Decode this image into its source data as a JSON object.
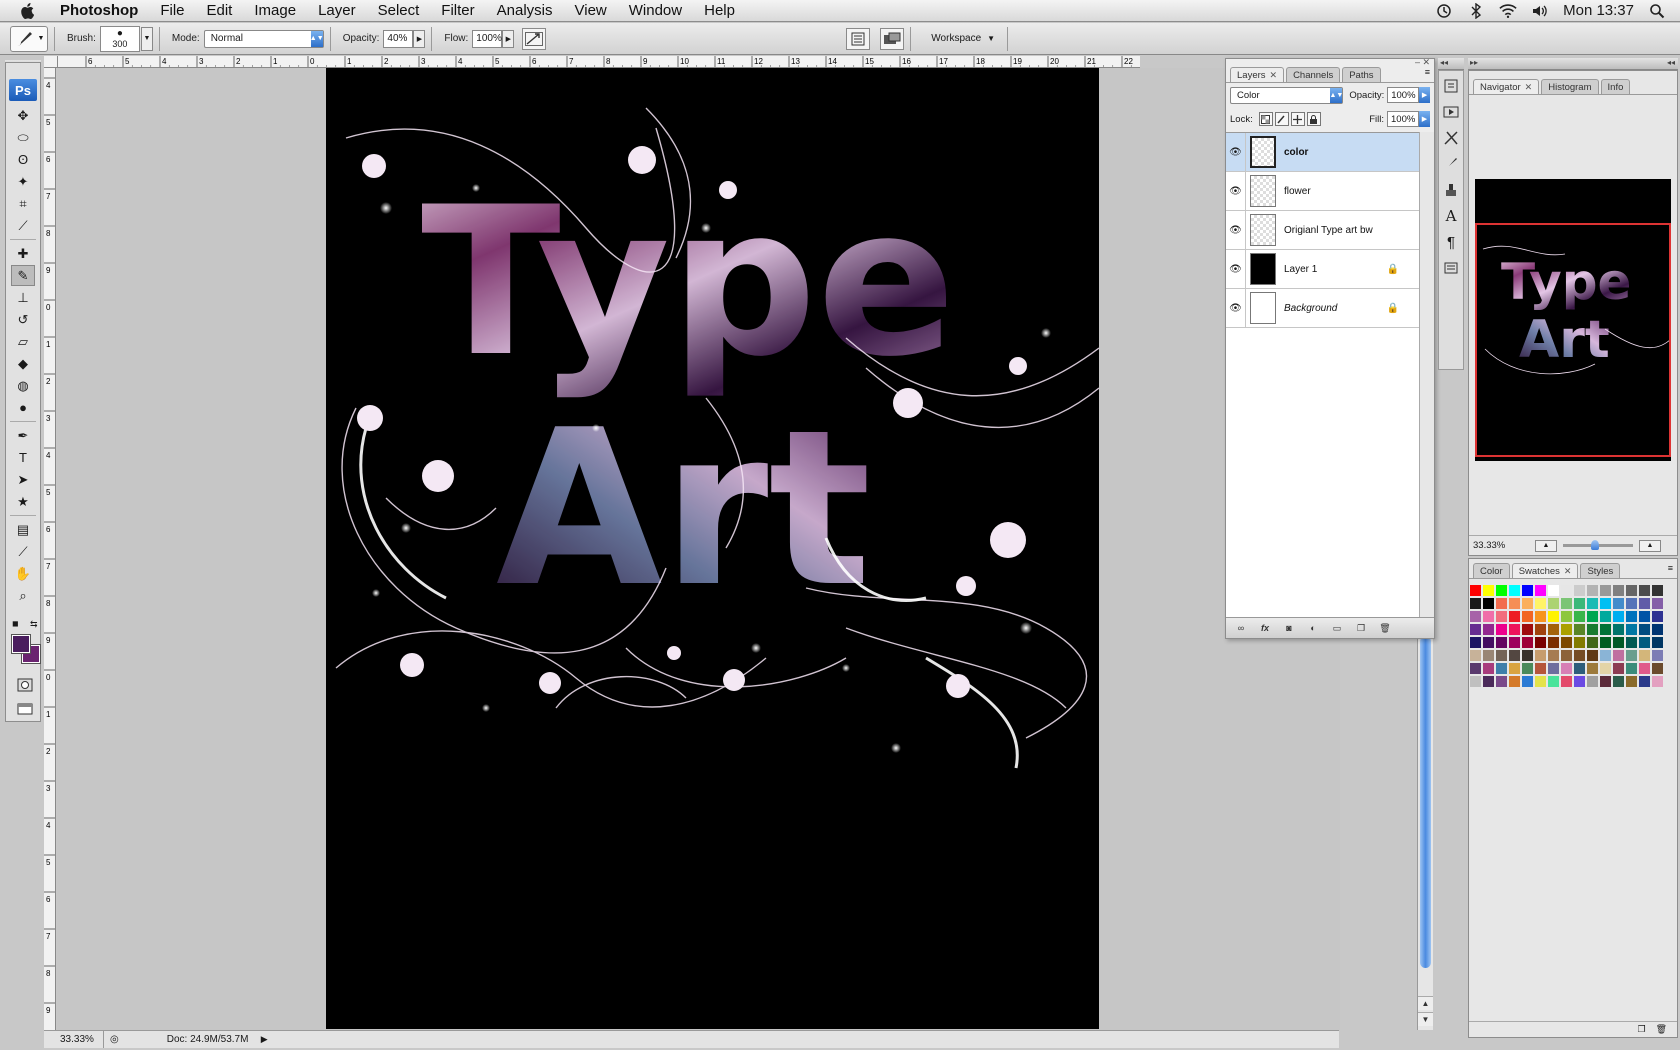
{
  "menubar": {
    "app_name": "Photoshop",
    "menus": [
      "File",
      "Edit",
      "Image",
      "Layer",
      "Select",
      "Filter",
      "Analysis",
      "View",
      "Window",
      "Help"
    ],
    "clock": "Mon 13:37",
    "status_icons": [
      "time-machine-icon",
      "bluetooth-icon",
      "wifi-icon",
      "volume-icon",
      "spotlight-search-icon"
    ]
  },
  "options_bar": {
    "brush_label": "Brush:",
    "brush_size": "300",
    "mode_label": "Mode:",
    "mode_value": "Normal",
    "opacity_label": "Opacity:",
    "opacity_value": "40%",
    "flow_label": "Flow:",
    "flow_value": "100%",
    "workspace_label": "Workspace"
  },
  "tools": {
    "logo": "Ps",
    "foreground_color": "#4a1d5e",
    "background_color": "#6a2370",
    "items": [
      "move-tool",
      "marquee-tool",
      "lasso-tool",
      "magic-wand-tool",
      "crop-tool",
      "eyedropper-tool",
      "healing-brush-tool",
      "brush-tool",
      "clone-stamp-tool",
      "history-brush-tool",
      "eraser-tool",
      "paint-bucket-tool",
      "blur-tool",
      "dodge-tool",
      "pen-tool",
      "type-tool",
      "path-selection-tool",
      "shape-tool",
      "notes-tool",
      "eyedropper-tool-2",
      "hand-tool",
      "zoom-tool"
    ]
  },
  "ruler": {
    "top_labels": [
      "6",
      "5",
      "4",
      "3",
      "2",
      "1",
      "0",
      "1",
      "2",
      "3",
      "4",
      "5",
      "6",
      "7",
      "8",
      "9",
      "10",
      "11",
      "12",
      "13",
      "14",
      "15",
      "16",
      "17",
      "18",
      "19",
      "20",
      "21",
      "22"
    ],
    "left_labels": [
      "4",
      "5",
      "6",
      "7",
      "8",
      "9",
      "0",
      "1",
      "2",
      "3",
      "4",
      "5",
      "6",
      "7",
      "8",
      "9",
      "0",
      "1",
      "2",
      "3",
      "4",
      "5",
      "6",
      "7",
      "8",
      "9",
      "0"
    ]
  },
  "canvas": {
    "artwork_title_line1": "Type",
    "artwork_title_line2": "Art"
  },
  "statusbar": {
    "zoom": "33.33%",
    "doc_size": "Doc: 24.9M/53.7M"
  },
  "layers_panel": {
    "tabs": [
      "Layers",
      "Channels",
      "Paths"
    ],
    "blend_mode": "Color",
    "opacity_label": "Opacity:",
    "opacity_value": "100%",
    "lock_label": "Lock:",
    "fill_label": "Fill:",
    "fill_value": "100%",
    "layers": [
      {
        "name": "color",
        "selected": true,
        "locked": false
      },
      {
        "name": "flower",
        "selected": false,
        "locked": false
      },
      {
        "name": "Origianl Type art bw",
        "selected": false,
        "locked": false
      },
      {
        "name": "Layer 1",
        "selected": false,
        "locked": true
      },
      {
        "name": "Background",
        "selected": false,
        "locked": true
      }
    ],
    "footer_icons": [
      "link-icon",
      "fx-icon",
      "mask-icon",
      "adjustment-icon",
      "folder-icon",
      "new-layer-icon",
      "trash-icon"
    ],
    "fx_label": "fx"
  },
  "navigator_panel": {
    "tabs": [
      "Navigator",
      "Histogram",
      "Info"
    ],
    "zoom": "33.33%"
  },
  "swatches_panel": {
    "tabs": [
      "Color",
      "Swatches",
      "Styles"
    ]
  }
}
